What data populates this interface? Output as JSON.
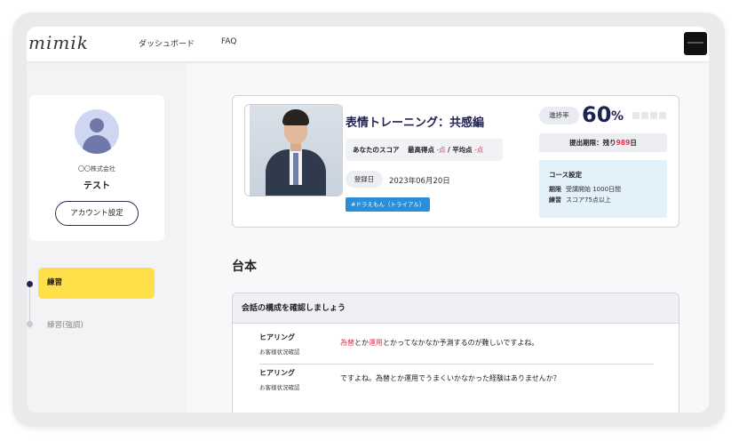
{
  "header": {
    "logo": "mimik",
    "nav": [
      "ダッシュボード",
      "FAQ"
    ]
  },
  "sidebar": {
    "company": "〇〇株式会社",
    "user_name": "テスト",
    "account_button": "アカウント設定",
    "steps": [
      {
        "label": "練習",
        "active": true
      },
      {
        "label": "練習(強調)",
        "active": false
      }
    ]
  },
  "course": {
    "title": "表情トレーニング：共感編",
    "score_label": "あなたのスコア",
    "best_label": "最高得点",
    "best_value": "-点",
    "separator": "/",
    "avg_label": "平均点",
    "avg_value": "-点",
    "registered_label": "登録日",
    "registered_date": "2023年06月20日",
    "tag": "#ドラえもん（トライアル）",
    "progress_label": "進捗率",
    "progress_value": "60",
    "progress_unit": "%",
    "progress_fraction": 0.6,
    "deadline_prefix": "提出期限：残り",
    "deadline_days": "989",
    "deadline_suffix": "日",
    "settings": {
      "title": "コース設定",
      "rows": [
        {
          "key": "期限",
          "value": "受講開始 1000日間"
        },
        {
          "key": "練習",
          "value": "スコア75点以上"
        }
      ]
    }
  },
  "script": {
    "title": "台本",
    "section_title": "会話の構成を確認しましょう",
    "rows": [
      {
        "speaker": "ヒアリング",
        "sub": "お客様状況確認",
        "parts": [
          "為替",
          "とか",
          "運用",
          "とかってなかなか予測するのが難しいですよね。"
        ]
      },
      {
        "speaker": "ヒアリング",
        "sub": "お客様状況確認",
        "text": "ですよね。為替とか運用でうまくいかなかった経験はありませんか？"
      }
    ]
  },
  "colors": {
    "navy": "#1f2350",
    "accent_yellow": "#ffdf4a",
    "highlight_red": "#e0344f",
    "tag_blue": "#2b8ed8"
  }
}
